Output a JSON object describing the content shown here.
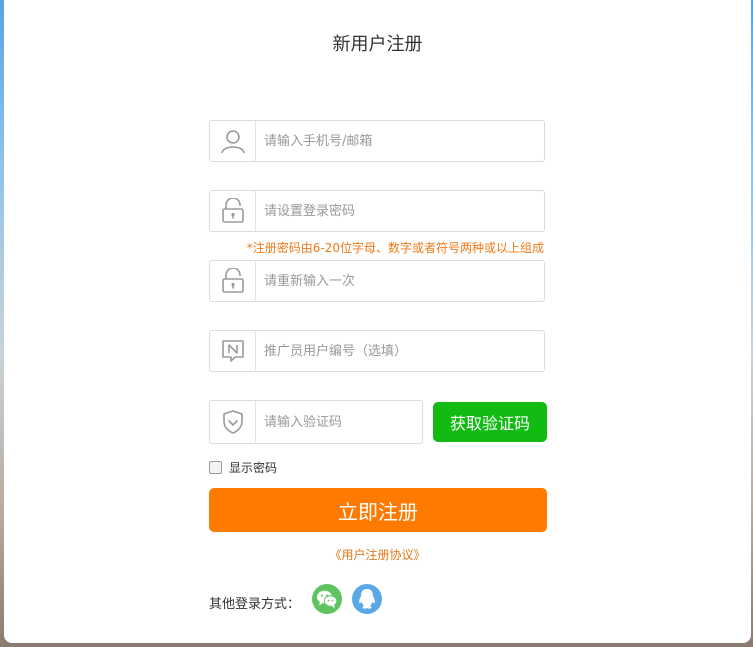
{
  "title": "新用户注册",
  "fields": {
    "account": {
      "placeholder": "请输入手机号/邮箱"
    },
    "password": {
      "placeholder": "请设置登录密码"
    },
    "password_hint": "*注册密码由6-20位字母、数字或者符号两种或以上组成",
    "confirm": {
      "placeholder": "请重新输入一次"
    },
    "referrer": {
      "placeholder": "推广员用户编号（选填）"
    },
    "code": {
      "placeholder": "请输入验证码"
    }
  },
  "get_code_label": "获取验证码",
  "show_password_label": "显示密码",
  "register_label": "立即注册",
  "agreement_label": "《用户注册协议》",
  "other_login_label": "其他登录方式：",
  "icons": {
    "user": "user-icon",
    "lock": "lock-icon",
    "referrer": "badge-n-icon",
    "shield": "shield-check-icon",
    "wechat": "wechat-icon",
    "qq": "qq-icon"
  },
  "colors": {
    "accent_orange": "#ff7a00",
    "green_button": "#12bb12",
    "hint_orange": "#f07a1a",
    "wechat_green": "#5fc35f",
    "qq_blue": "#5aa8e6"
  }
}
